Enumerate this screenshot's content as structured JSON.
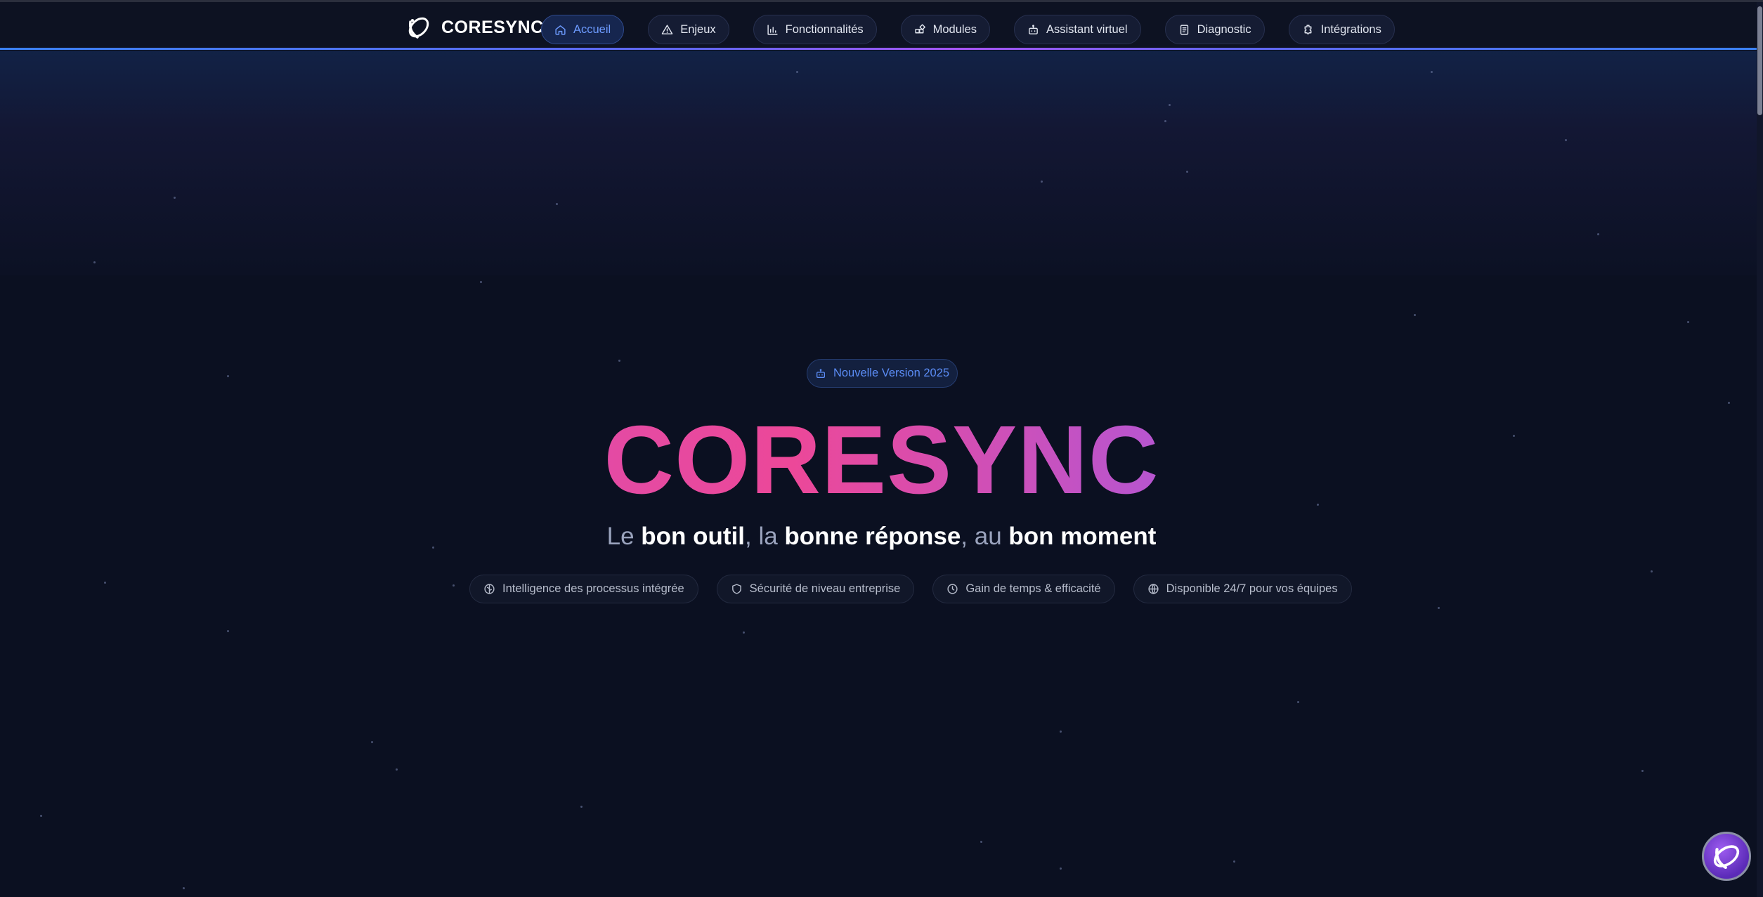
{
  "brand": {
    "name": "CORESYNC"
  },
  "nav": {
    "items": [
      {
        "label": "Accueil",
        "icon": "home-icon",
        "active": true
      },
      {
        "label": "Enjeux",
        "icon": "alert-triangle-icon",
        "active": false
      },
      {
        "label": "Fonctionnalités",
        "icon": "bar-chart-icon",
        "active": false
      },
      {
        "label": "Modules",
        "icon": "modules-icon",
        "active": false
      },
      {
        "label": "Assistant virtuel",
        "icon": "bot-icon",
        "active": false
      },
      {
        "label": "Diagnostic",
        "icon": "clipboard-icon",
        "active": false
      },
      {
        "label": "Intégrations",
        "icon": "puzzle-icon",
        "active": false
      }
    ]
  },
  "hero": {
    "badge": "Nouvelle Version 2025",
    "title": "CORESYNC",
    "tagline": {
      "p1": "Le ",
      "b1": "bon outil",
      "p2": ", la ",
      "b2": "bonne réponse",
      "p3": ", au ",
      "b3": "bon moment"
    },
    "features": [
      {
        "label": "Intelligence des processus intégrée",
        "icon": "brain-icon"
      },
      {
        "label": "Sécurité de niveau entreprise",
        "icon": "shield-icon"
      },
      {
        "label": "Gain de temps & efficacité",
        "icon": "clock-icon"
      },
      {
        "label": "Disponible 24/7 pour vos équipes",
        "icon": "globe-icon"
      }
    ]
  },
  "colors": {
    "background": "#0b1021",
    "accent": "#4f6cf0",
    "active_nav": "#6d9bff",
    "title_gradient": [
      "#b455e0",
      "#ec4899",
      "#5f73e8"
    ]
  }
}
